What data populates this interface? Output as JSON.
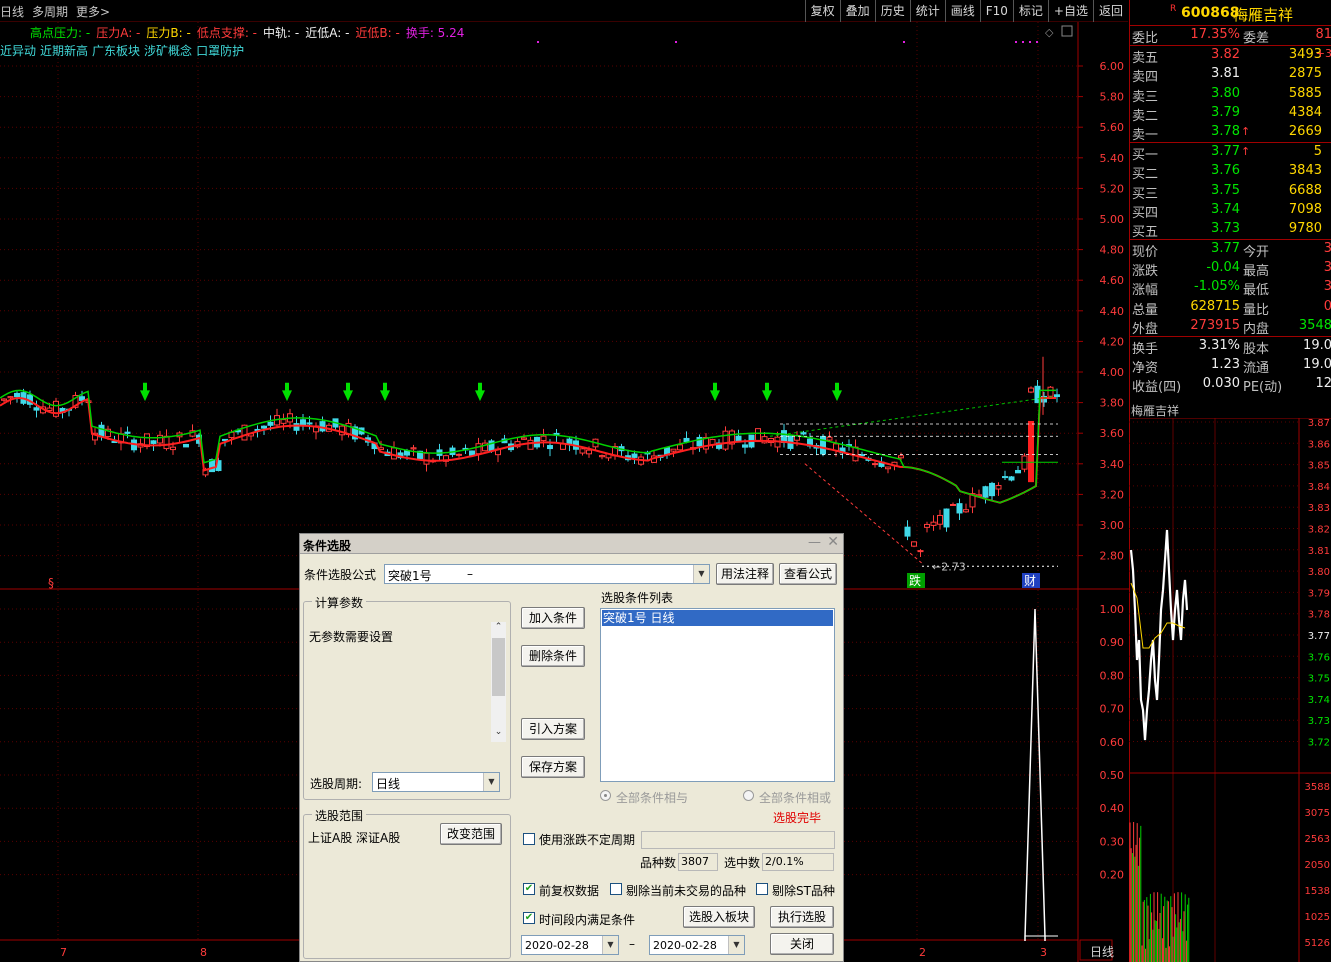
{
  "toolbar": {
    "left": [
      "日线",
      "多周期",
      "更多>"
    ],
    "right": [
      "复权",
      "叠加",
      "历史",
      "统计",
      "画线",
      "F10",
      "标记",
      "+自选",
      "返回"
    ]
  },
  "indicator_line": [
    {
      "text": "高点压力: -",
      "color": "#00e600"
    },
    {
      "text": "压力A: -",
      "color": "#ff3b3b"
    },
    {
      "text": "压力B: -",
      "color": "#ffd700"
    },
    {
      "text": "低点支撑: -",
      "color": "#ff3b3b"
    },
    {
      "text": "中轨: -",
      "color": "#f0f0f0"
    },
    {
      "text": "近低A: -",
      "color": "#f0f0f0"
    },
    {
      "text": "近低B: -",
      "color": "#ff3b3b"
    },
    {
      "text": "换手: 5.24",
      "color": "#e020e0"
    }
  ],
  "tags": [
    "近异动",
    "近期新高",
    "广东板块",
    "涉矿概念",
    "口罩防护"
  ],
  "chart": {
    "price_axis": [
      "6.00",
      "5.80",
      "5.60",
      "5.40",
      "5.20",
      "5.00",
      "4.80",
      "4.60",
      "4.40",
      "4.20",
      "4.00",
      "3.80",
      "3.60",
      "3.40",
      "3.20",
      "3.00",
      "2.80"
    ],
    "volume_axis": [
      "1.00",
      "0.90",
      "0.80",
      "0.70",
      "0.60",
      "0.50",
      "0.40",
      "0.30",
      "0.20"
    ],
    "low_label": "2.73",
    "markers": {
      "s": "§",
      "die": "跌",
      "cai": "财"
    },
    "date_labels": [
      "7",
      "8",
      "2",
      "3"
    ]
  },
  "quote": {
    "code": "600868",
    "name": "梅雁吉祥",
    "weibi_label": "委比",
    "weibi": "17.35%",
    "weicha_label": "委差",
    "weicha": "81",
    "asks": [
      {
        "label": "卖五",
        "price": "3.82",
        "vol": "3493",
        "extra": "+3"
      },
      {
        "label": "卖四",
        "price": "3.81",
        "vol": "2875",
        "extra": ""
      },
      {
        "label": "卖三",
        "price": "3.80",
        "vol": "5885",
        "extra": ""
      },
      {
        "label": "卖二",
        "price": "3.79",
        "vol": "4384",
        "extra": ""
      },
      {
        "label": "卖一",
        "price": "3.78",
        "vol": "2669",
        "extra": ""
      }
    ],
    "bids": [
      {
        "label": "买一",
        "price": "3.77",
        "vol": "5"
      },
      {
        "label": "买二",
        "price": "3.76",
        "vol": "3843"
      },
      {
        "label": "买三",
        "price": "3.75",
        "vol": "6688"
      },
      {
        "label": "买四",
        "price": "3.74",
        "vol": "7098"
      },
      {
        "label": "买五",
        "price": "3.73",
        "vol": "9780"
      }
    ],
    "stats": [
      {
        "l1": "现价",
        "v1": "3.77",
        "c1": "grn",
        "l2": "今开",
        "v2": "3"
      },
      {
        "l1": "涨跌",
        "v1": "-0.04",
        "c1": "grn",
        "l2": "最高",
        "v2": "3"
      },
      {
        "l1": "涨幅",
        "v1": "-1.05%",
        "c1": "grn",
        "l2": "最低",
        "v2": "3"
      },
      {
        "l1": "总量",
        "v1": "628715",
        "c1": "yel",
        "l2": "量比",
        "v2": "0"
      },
      {
        "l1": "外盘",
        "v1": "273915",
        "c1": "red",
        "l2": "内盘",
        "v2": "3548"
      }
    ],
    "stats2": [
      {
        "l1": "换手",
        "v1": "3.31%",
        "l2": "股本",
        "v2": "19.0"
      },
      {
        "l1": "净资",
        "v1": "1.23",
        "l2": "流通",
        "v2": "19.0"
      },
      {
        "l1": "收益(四)",
        "v1": "0.030",
        "l2": "PE(动)",
        "v2": "12"
      }
    ],
    "mini_title": "梅雁吉祥",
    "mini_axis": [
      "3.87",
      "3.86",
      "3.85",
      "3.84",
      "3.83",
      "3.82",
      "3.81",
      "3.80",
      "3.79",
      "3.78",
      "3.77",
      "3.76",
      "3.75",
      "3.74",
      "3.73",
      "3.72"
    ],
    "mini_vol_axis": [
      "3588",
      "3075",
      "2563",
      "2050",
      "1538",
      "1025",
      "5126"
    ],
    "bottom_tab": "日线"
  },
  "dialog": {
    "title": "条件选股",
    "formula_label": "条件选股公式",
    "formula_value": "突破1号",
    "formula_dash": "–",
    "btn_usage": "用法注释",
    "btn_view": "查看公式",
    "params_group": "计算参数",
    "params_text": "无参数需要设置",
    "period_label": "选股周期:",
    "period_value": "日线",
    "btn_add": "加入条件",
    "btn_delete": "删除条件",
    "btn_import": "引入方案",
    "btn_save": "保存方案",
    "list_label": "选股条件列表",
    "list_items": [
      "突破1号   日线"
    ],
    "radio_and": "全部条件相与",
    "radio_or": "全部条件相或",
    "status": "选股完毕",
    "range_group": "选股范围",
    "range_text": "上证A股  深证A股",
    "btn_range": "改变范围",
    "chk_variable": "使用涨跌不定周期",
    "count_label": "品种数",
    "count_value": "3807",
    "selected_label": "选中数",
    "selected_value": "2/0.1%",
    "chk_fuquan": "前复权数据",
    "chk_exclude_untraded": "剔除当前未交易的品种",
    "chk_exclude_st": "剔除ST品种",
    "chk_period": "时间段内满足条件",
    "btn_to_block": "选股入板块",
    "btn_execute": "执行选股",
    "date_from": "2020-02-28",
    "date_sep": "–",
    "date_to": "2020-02-28",
    "btn_close": "关闭"
  }
}
